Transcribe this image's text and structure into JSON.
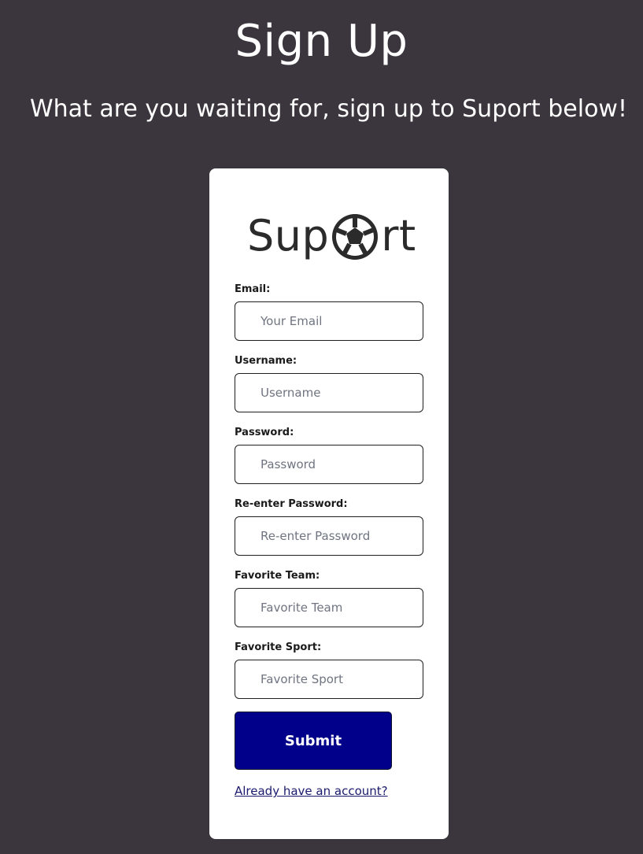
{
  "page": {
    "title": "Sign Up",
    "subtitle": "What are you waiting for, sign up to Suport below!"
  },
  "logo": {
    "prefix": "Sup",
    "suffix": "rt",
    "icon": "soccer-ball-icon"
  },
  "form": {
    "fields": [
      {
        "label": "Email:",
        "placeholder": "Your Email",
        "value": ""
      },
      {
        "label": "Username:",
        "placeholder": "Username",
        "value": ""
      },
      {
        "label": "Password:",
        "placeholder": "Password",
        "value": ""
      },
      {
        "label": "Re-enter Password:",
        "placeholder": "Re-enter Password",
        "value": ""
      },
      {
        "label": "Favorite Team:",
        "placeholder": "Favorite Team",
        "value": ""
      },
      {
        "label": "Favorite Sport:",
        "placeholder": "Favorite Sport",
        "value": ""
      }
    ],
    "submit_label": "Submit",
    "login_link": "Already have an account?"
  },
  "colors": {
    "background": "#3b353d",
    "card": "#ffffff",
    "button": "#00008b",
    "link": "#1a1a6e"
  }
}
